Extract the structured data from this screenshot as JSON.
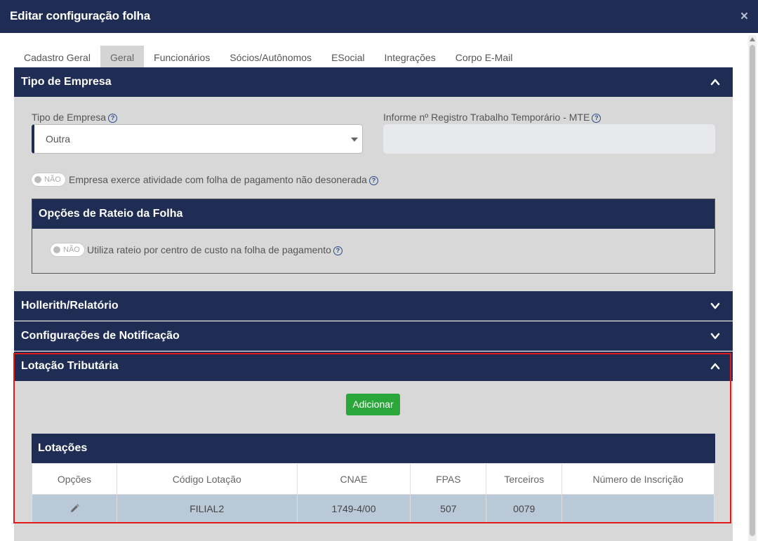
{
  "modal": {
    "title": "Editar configuração folha",
    "close_glyph": "×"
  },
  "tabs": [
    {
      "label": "Cadastro Geral",
      "active": false
    },
    {
      "label": "Geral",
      "active": true
    },
    {
      "label": "Funcionários",
      "active": false
    },
    {
      "label": "Sócios/Autônomos",
      "active": false
    },
    {
      "label": "ESocial",
      "active": false
    },
    {
      "label": "Integrações",
      "active": false
    },
    {
      "label": "Corpo E-Mail",
      "active": false
    }
  ],
  "tipo_empresa": {
    "title": "Tipo de Empresa",
    "expanded": true,
    "tipo_label": "Tipo de Empresa",
    "tipo_value": "Outra",
    "registro_label": "Informe nº Registro Trabalho Temporário - MTE",
    "registro_value": "",
    "desonerada_toggle": "NÃO",
    "desonerada_text": "Empresa exerce atividade com folha de pagamento não desonerada",
    "rateio": {
      "title": "Opções de Rateio da Folha",
      "toggle": "NÃO",
      "text": "Utiliza rateio por centro de custo na folha de pagamento"
    }
  },
  "hollerith": {
    "title": "Hollerith/Relatório",
    "expanded": false
  },
  "notificacao": {
    "title": "Configurações de Notificação",
    "expanded": false
  },
  "lotacao": {
    "title": "Lotação Tributária",
    "expanded": true,
    "add_button": "Adicionar",
    "table_title": "Lotações",
    "columns": [
      "Opções",
      "Código Lotação",
      "CNAE",
      "FPAS",
      "Terceiros",
      "Número de Inscrição"
    ],
    "rows": [
      {
        "codigo": "FILIAL2",
        "cnae": "1749-4/00",
        "fpas": "507",
        "terceiros": "0079",
        "inscricao": ""
      }
    ]
  },
  "colors": {
    "header_navy": "#1f2d54",
    "panel_gray": "#d8d8d8",
    "add_green": "#2aa63b",
    "row_blue": "#b9c9d8",
    "highlight_red": "#e11b1b"
  },
  "icons": {
    "close": "close-icon",
    "chevron_up": "chevron-up-icon",
    "chevron_down": "chevron-down-icon",
    "help": "help-circle-icon",
    "edit": "pencil-icon"
  }
}
